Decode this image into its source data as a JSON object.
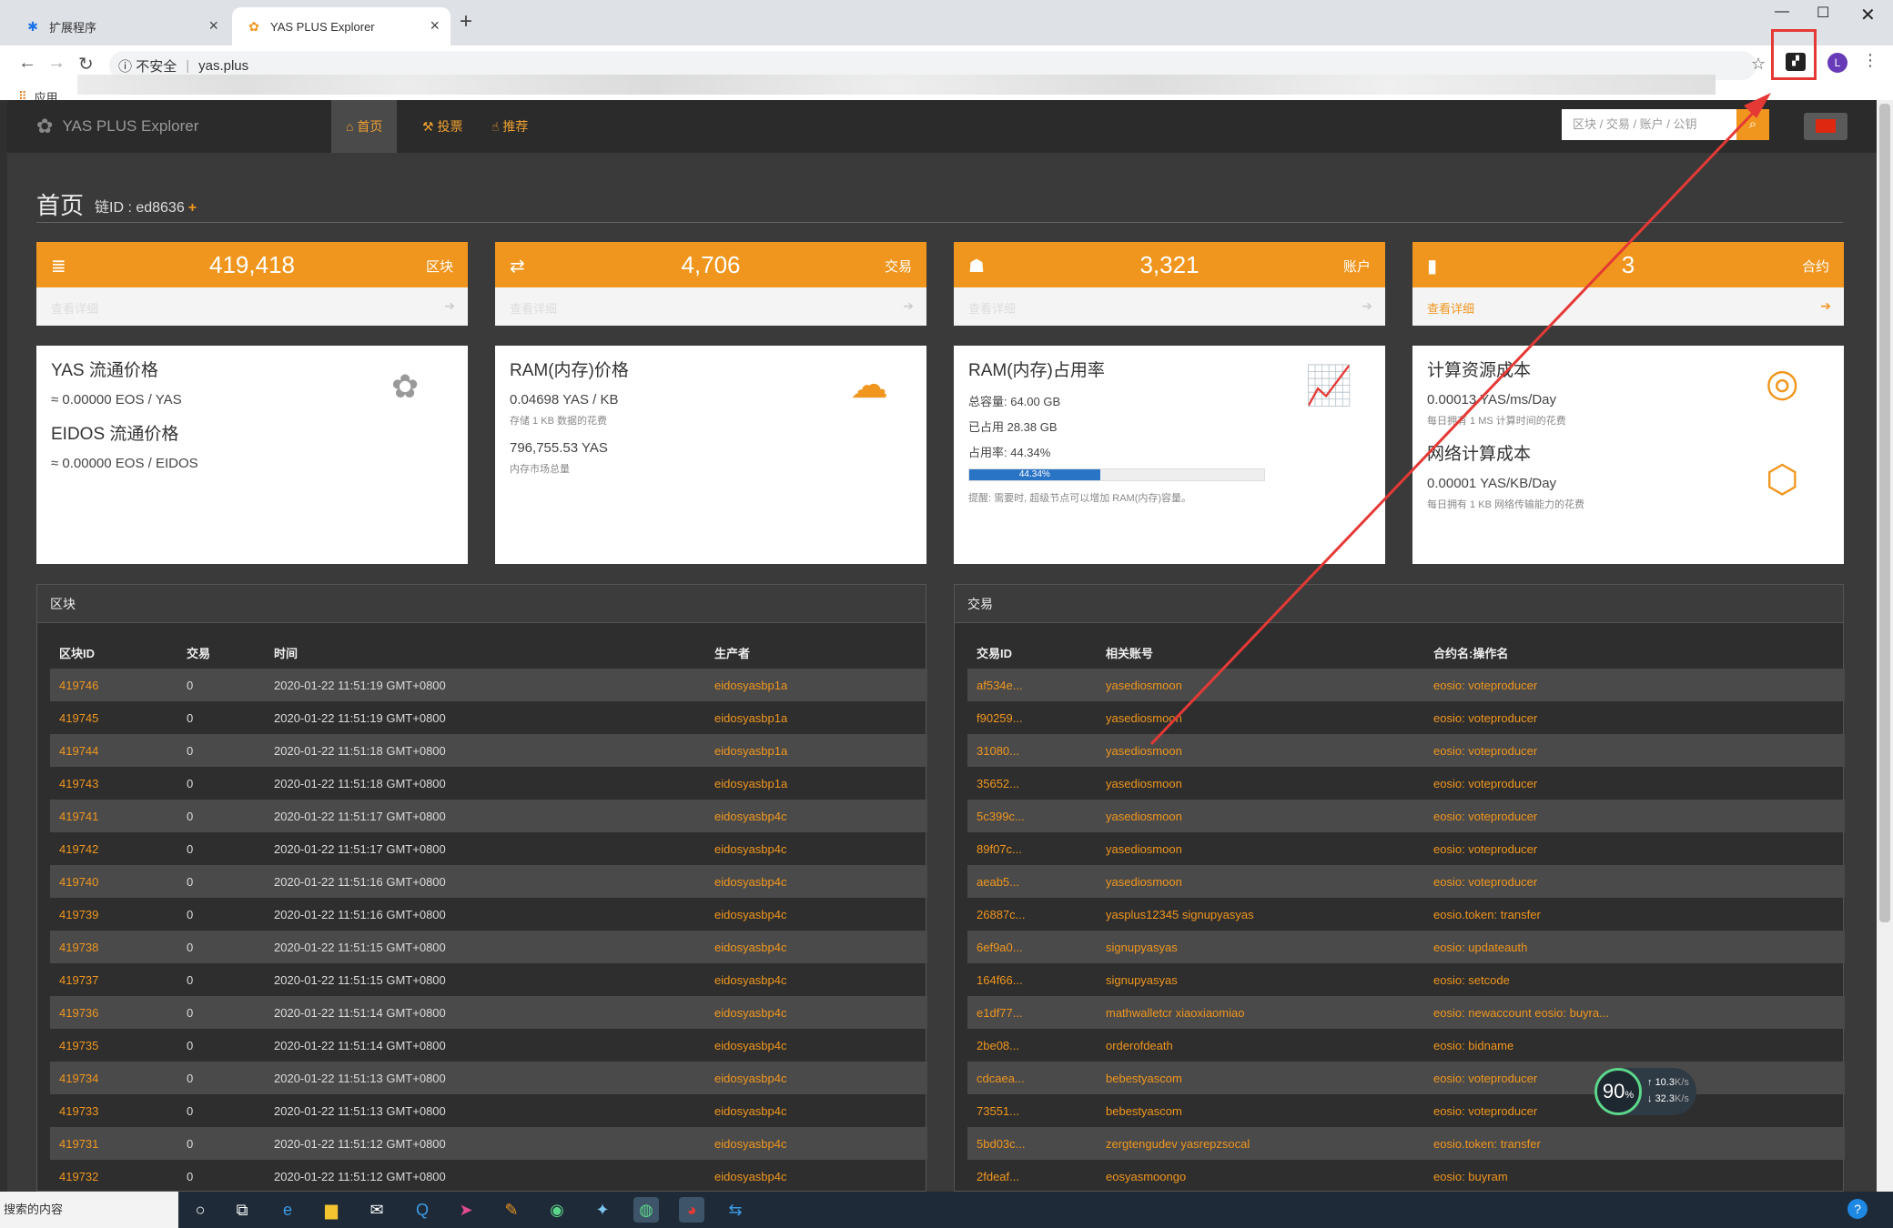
{
  "browser": {
    "tabs": [
      {
        "title": "扩展程序",
        "icon": "puzzle-icon"
      },
      {
        "title": "YAS PLUS Explorer",
        "icon": "yas-logo-icon"
      }
    ],
    "security": "不安全",
    "url": "yas.plus",
    "bookmarks_label": "应用",
    "avatar_letter": "L"
  },
  "site": {
    "logo_text": "YAS PLUS Explorer",
    "nav": [
      "首页",
      "投票",
      "推荐"
    ],
    "search_placeholder": "区块 / 交易 / 账户 / 公钥"
  },
  "page": {
    "title": "首页",
    "chain_id": "链ID : ed8636"
  },
  "stats": [
    {
      "value": "419,418",
      "label": "区块",
      "link": "查看详细",
      "icon": "database-icon"
    },
    {
      "value": "4,706",
      "label": "交易",
      "link": "查看详细",
      "icon": "exchange-icon"
    },
    {
      "value": "3,321",
      "label": "账户",
      "link": "查看详细",
      "icon": "user-icon"
    },
    {
      "value": "3",
      "label": "合约",
      "link": "查看详细",
      "icon": "file-icon"
    }
  ],
  "yas_price": {
    "title": "YAS 流通价格",
    "value": "≈ 0.00000 EOS / YAS",
    "title2": "EIDOS 流通价格",
    "value2": "≈ 0.00000 EOS / EIDOS"
  },
  "ram_price": {
    "title": "RAM(内存)价格",
    "value": "0.04698 YAS / KB",
    "note": "存储 1 KB 数据的花费",
    "value2": "796,755.53 YAS",
    "note2": "内存市场总量"
  },
  "ram_usage": {
    "title": "RAM(内存)占用率",
    "total": "总容量: 64.00 GB",
    "used": "已占用 28.38 GB",
    "rate": "占用率: 44.34%",
    "bar_label": "44.34%",
    "percent": 44.34,
    "tip": "提醒: 需要时, 超级节点可以增加 RAM(内存)容量。"
  },
  "compute": {
    "title": "计算资源成本",
    "value": "0.00013 YAS/ms/Day",
    "note": "每日拥有 1 MS 计算时间的花费",
    "title2": "网络计算成本",
    "value2": "0.00001 YAS/KB/Day",
    "note2": "每日拥有 1 KB 网络传输能力的花费"
  },
  "blocks": {
    "title": "区块",
    "headers": [
      "区块ID",
      "交易",
      "时间",
      "生产者"
    ],
    "rows": [
      [
        "419746",
        "0",
        "2020-01-22 11:51:19 GMT+0800",
        "eidosyasbp1a"
      ],
      [
        "419745",
        "0",
        "2020-01-22 11:51:19 GMT+0800",
        "eidosyasbp1a"
      ],
      [
        "419744",
        "0",
        "2020-01-22 11:51:18 GMT+0800",
        "eidosyasbp1a"
      ],
      [
        "419743",
        "0",
        "2020-01-22 11:51:18 GMT+0800",
        "eidosyasbp1a"
      ],
      [
        "419741",
        "0",
        "2020-01-22 11:51:17 GMT+0800",
        "eidosyasbp4c"
      ],
      [
        "419742",
        "0",
        "2020-01-22 11:51:17 GMT+0800",
        "eidosyasbp4c"
      ],
      [
        "419740",
        "0",
        "2020-01-22 11:51:16 GMT+0800",
        "eidosyasbp4c"
      ],
      [
        "419739",
        "0",
        "2020-01-22 11:51:16 GMT+0800",
        "eidosyasbp4c"
      ],
      [
        "419738",
        "0",
        "2020-01-22 11:51:15 GMT+0800",
        "eidosyasbp4c"
      ],
      [
        "419737",
        "0",
        "2020-01-22 11:51:15 GMT+0800",
        "eidosyasbp4c"
      ],
      [
        "419736",
        "0",
        "2020-01-22 11:51:14 GMT+0800",
        "eidosyasbp4c"
      ],
      [
        "419735",
        "0",
        "2020-01-22 11:51:14 GMT+0800",
        "eidosyasbp4c"
      ],
      [
        "419734",
        "0",
        "2020-01-22 11:51:13 GMT+0800",
        "eidosyasbp4c"
      ],
      [
        "419733",
        "0",
        "2020-01-22 11:51:13 GMT+0800",
        "eidosyasbp4c"
      ],
      [
        "419731",
        "0",
        "2020-01-22 11:51:12 GMT+0800",
        "eidosyasbp4c"
      ],
      [
        "419732",
        "0",
        "2020-01-22 11:51:12 GMT+0800",
        "eidosyasbp4c"
      ]
    ]
  },
  "txs": {
    "title": "交易",
    "headers": [
      "交易ID",
      "相关账号",
      "合约名:操作名"
    ],
    "rows": [
      [
        "af534e...",
        "yasediosmoon",
        "eosio: voteproducer"
      ],
      [
        "f90259...",
        "yasediosmoon",
        "eosio: voteproducer"
      ],
      [
        "31080...",
        "yasediosmoon",
        "eosio: voteproducer"
      ],
      [
        "35652...",
        "yasediosmoon",
        "eosio: voteproducer"
      ],
      [
        "5c399c...",
        "yasediosmoon",
        "eosio: voteproducer"
      ],
      [
        "89f07c...",
        "yasediosmoon",
        "eosio: voteproducer"
      ],
      [
        "aeab5...",
        "yasediosmoon",
        "eosio: voteproducer"
      ],
      [
        "26887c...",
        "yasplus12345 signupyasyas",
        "eosio.token: transfer"
      ],
      [
        "6ef9a0...",
        "signupyasyas",
        "eosio: updateauth"
      ],
      [
        "164f66...",
        "signupyasyas",
        "eosio: setcode"
      ],
      [
        "e1df77...",
        "mathwalletcr xiaoxiaomiao",
        "eosio: newaccount eosio: buyra..."
      ],
      [
        "2be08...",
        "orderofdeath",
        "eosio: bidname"
      ],
      [
        "cdcaea...",
        "bebestyascom",
        "eosio: voteproducer"
      ],
      [
        "73551...",
        "bebestyascom",
        "eosio: voteproducer"
      ],
      [
        "5bd03c...",
        "zergtengudev yasrepzsocal",
        "eosio.token: transfer"
      ],
      [
        "2fdeaf...",
        "eosyasmoongo",
        "eosio: buyram"
      ]
    ]
  },
  "gauge": {
    "percent": "90",
    "unit": "%",
    "up": "10.3",
    "down": "32.3",
    "rate_unit": "K/s"
  },
  "taskbar": {
    "search_text": "搜索的内容"
  },
  "annotation_color": "#e53935"
}
